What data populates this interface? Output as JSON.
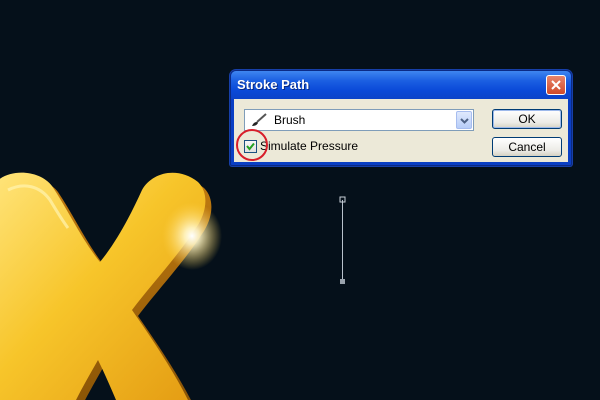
{
  "dialog": {
    "title": "Stroke Path",
    "tool_select": {
      "value": "Brush",
      "icon": "brush-icon"
    },
    "simulate_pressure": {
      "label": "Simulate Pressure",
      "checked": true
    },
    "ok_label": "OK",
    "cancel_label": "Cancel",
    "close_icon": "close-icon"
  },
  "colors": {
    "background": "#05101a",
    "title_bar": "#0a49d8",
    "dialog_body": "#ece9d8",
    "highlight_circle": "#d81e2a",
    "gold": "#f6c22e"
  }
}
